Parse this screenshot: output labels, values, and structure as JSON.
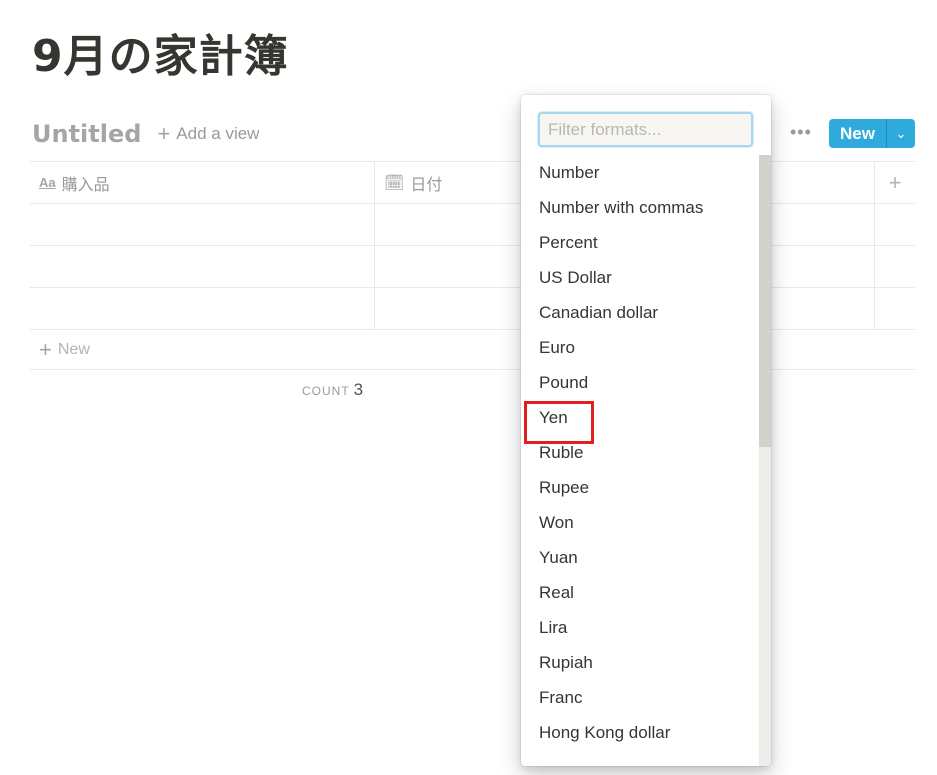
{
  "page": {
    "title": "9月の家計簿"
  },
  "view": {
    "name": "Untitled",
    "add_view": "Add a view",
    "new_label": "New"
  },
  "table": {
    "columns": [
      {
        "name": "購入品",
        "icon": "title-aa-icon"
      },
      {
        "name": "日付",
        "icon": "calendar-icon"
      }
    ],
    "rows": 3,
    "new_row": "New",
    "count_label": "COUNT",
    "count_value": "3"
  },
  "dropdown": {
    "placeholder": "Filter formats...",
    "selected": "Yen",
    "items": [
      "Number",
      "Number with commas",
      "Percent",
      "US Dollar",
      "Canadian dollar",
      "Euro",
      "Pound",
      "Yen",
      "Ruble",
      "Rupee",
      "Won",
      "Yuan",
      "Real",
      "Lira",
      "Rupiah",
      "Franc",
      "Hong Kong dollar"
    ]
  },
  "colors": {
    "accent": "#2eaadc"
  }
}
